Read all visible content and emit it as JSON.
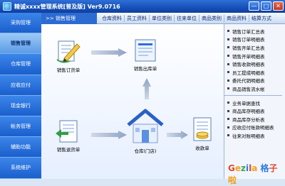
{
  "window": {
    "title": "精诚xxxx管理系统[普及版] Ver9.0716",
    "buttons": [
      "—",
      "□",
      "✕"
    ]
  },
  "sidebar": {
    "items": [
      {
        "label": "采购管理"
      },
      {
        "label": "销售管理",
        "active": true
      },
      {
        "label": "仓库管理"
      },
      {
        "label": "应收应付"
      },
      {
        "label": "现金银行"
      },
      {
        "label": "帐务管理"
      },
      {
        "label": "辅助功能"
      },
      {
        "label": "系统维护"
      }
    ]
  },
  "breadcrumb": ">> 销售管理",
  "tabs": [
    "仓库资料",
    "员工资料",
    "单位类别",
    "往来单位",
    "商品类别",
    "商品资料",
    "结算方式"
  ],
  "flow": {
    "nodes": {
      "order": "销售订货单",
      "outbound": "销售出库单",
      "return": "销售退货单",
      "warehouse": "仓库(门店)",
      "receipt": "收款单"
    }
  },
  "rightpanel": {
    "group1": [
      "销售订单汇总表",
      "销售订单明细表",
      "销售开单汇总表",
      "销售开单明细表",
      "销售收款明细表",
      "员工提成明细表",
      "委托代销明细表",
      "商品销售流水帐"
    ],
    "group2": [
      "业务单据查找",
      "商品库存明细表",
      "商品库存分析表",
      "应收应付账款明细表",
      "往来对账明细表"
    ]
  },
  "watermark": "Gezila 格子啦",
  "colors": {
    "accent": "#1f6ad8",
    "sidebar": "#1f6ad8",
    "watermark": [
      "#e2472b",
      "#f3a11b",
      "#34a853",
      "#2a7de1"
    ]
  }
}
